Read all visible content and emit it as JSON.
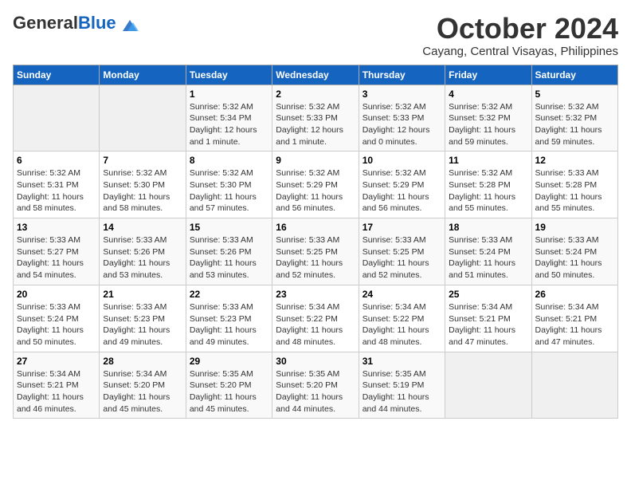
{
  "header": {
    "logo": {
      "general": "General",
      "blue": "Blue"
    },
    "title": "October 2024",
    "location": "Cayang, Central Visayas, Philippines"
  },
  "weekdays": [
    "Sunday",
    "Monday",
    "Tuesday",
    "Wednesday",
    "Thursday",
    "Friday",
    "Saturday"
  ],
  "weeks": [
    [
      {
        "day": "",
        "sunrise": "",
        "sunset": "",
        "daylight": ""
      },
      {
        "day": "",
        "sunrise": "",
        "sunset": "",
        "daylight": ""
      },
      {
        "day": "1",
        "sunrise": "Sunrise: 5:32 AM",
        "sunset": "Sunset: 5:34 PM",
        "daylight": "Daylight: 12 hours and 1 minute."
      },
      {
        "day": "2",
        "sunrise": "Sunrise: 5:32 AM",
        "sunset": "Sunset: 5:33 PM",
        "daylight": "Daylight: 12 hours and 1 minute."
      },
      {
        "day": "3",
        "sunrise": "Sunrise: 5:32 AM",
        "sunset": "Sunset: 5:33 PM",
        "daylight": "Daylight: 12 hours and 0 minutes."
      },
      {
        "day": "4",
        "sunrise": "Sunrise: 5:32 AM",
        "sunset": "Sunset: 5:32 PM",
        "daylight": "Daylight: 11 hours and 59 minutes."
      },
      {
        "day": "5",
        "sunrise": "Sunrise: 5:32 AM",
        "sunset": "Sunset: 5:32 PM",
        "daylight": "Daylight: 11 hours and 59 minutes."
      }
    ],
    [
      {
        "day": "6",
        "sunrise": "Sunrise: 5:32 AM",
        "sunset": "Sunset: 5:31 PM",
        "daylight": "Daylight: 11 hours and 58 minutes."
      },
      {
        "day": "7",
        "sunrise": "Sunrise: 5:32 AM",
        "sunset": "Sunset: 5:30 PM",
        "daylight": "Daylight: 11 hours and 58 minutes."
      },
      {
        "day": "8",
        "sunrise": "Sunrise: 5:32 AM",
        "sunset": "Sunset: 5:30 PM",
        "daylight": "Daylight: 11 hours and 57 minutes."
      },
      {
        "day": "9",
        "sunrise": "Sunrise: 5:32 AM",
        "sunset": "Sunset: 5:29 PM",
        "daylight": "Daylight: 11 hours and 56 minutes."
      },
      {
        "day": "10",
        "sunrise": "Sunrise: 5:32 AM",
        "sunset": "Sunset: 5:29 PM",
        "daylight": "Daylight: 11 hours and 56 minutes."
      },
      {
        "day": "11",
        "sunrise": "Sunrise: 5:32 AM",
        "sunset": "Sunset: 5:28 PM",
        "daylight": "Daylight: 11 hours and 55 minutes."
      },
      {
        "day": "12",
        "sunrise": "Sunrise: 5:33 AM",
        "sunset": "Sunset: 5:28 PM",
        "daylight": "Daylight: 11 hours and 55 minutes."
      }
    ],
    [
      {
        "day": "13",
        "sunrise": "Sunrise: 5:33 AM",
        "sunset": "Sunset: 5:27 PM",
        "daylight": "Daylight: 11 hours and 54 minutes."
      },
      {
        "day": "14",
        "sunrise": "Sunrise: 5:33 AM",
        "sunset": "Sunset: 5:26 PM",
        "daylight": "Daylight: 11 hours and 53 minutes."
      },
      {
        "day": "15",
        "sunrise": "Sunrise: 5:33 AM",
        "sunset": "Sunset: 5:26 PM",
        "daylight": "Daylight: 11 hours and 53 minutes."
      },
      {
        "day": "16",
        "sunrise": "Sunrise: 5:33 AM",
        "sunset": "Sunset: 5:25 PM",
        "daylight": "Daylight: 11 hours and 52 minutes."
      },
      {
        "day": "17",
        "sunrise": "Sunrise: 5:33 AM",
        "sunset": "Sunset: 5:25 PM",
        "daylight": "Daylight: 11 hours and 52 minutes."
      },
      {
        "day": "18",
        "sunrise": "Sunrise: 5:33 AM",
        "sunset": "Sunset: 5:24 PM",
        "daylight": "Daylight: 11 hours and 51 minutes."
      },
      {
        "day": "19",
        "sunrise": "Sunrise: 5:33 AM",
        "sunset": "Sunset: 5:24 PM",
        "daylight": "Daylight: 11 hours and 50 minutes."
      }
    ],
    [
      {
        "day": "20",
        "sunrise": "Sunrise: 5:33 AM",
        "sunset": "Sunset: 5:24 PM",
        "daylight": "Daylight: 11 hours and 50 minutes."
      },
      {
        "day": "21",
        "sunrise": "Sunrise: 5:33 AM",
        "sunset": "Sunset: 5:23 PM",
        "daylight": "Daylight: 11 hours and 49 minutes."
      },
      {
        "day": "22",
        "sunrise": "Sunrise: 5:33 AM",
        "sunset": "Sunset: 5:23 PM",
        "daylight": "Daylight: 11 hours and 49 minutes."
      },
      {
        "day": "23",
        "sunrise": "Sunrise: 5:34 AM",
        "sunset": "Sunset: 5:22 PM",
        "daylight": "Daylight: 11 hours and 48 minutes."
      },
      {
        "day": "24",
        "sunrise": "Sunrise: 5:34 AM",
        "sunset": "Sunset: 5:22 PM",
        "daylight": "Daylight: 11 hours and 48 minutes."
      },
      {
        "day": "25",
        "sunrise": "Sunrise: 5:34 AM",
        "sunset": "Sunset: 5:21 PM",
        "daylight": "Daylight: 11 hours and 47 minutes."
      },
      {
        "day": "26",
        "sunrise": "Sunrise: 5:34 AM",
        "sunset": "Sunset: 5:21 PM",
        "daylight": "Daylight: 11 hours and 47 minutes."
      }
    ],
    [
      {
        "day": "27",
        "sunrise": "Sunrise: 5:34 AM",
        "sunset": "Sunset: 5:21 PM",
        "daylight": "Daylight: 11 hours and 46 minutes."
      },
      {
        "day": "28",
        "sunrise": "Sunrise: 5:34 AM",
        "sunset": "Sunset: 5:20 PM",
        "daylight": "Daylight: 11 hours and 45 minutes."
      },
      {
        "day": "29",
        "sunrise": "Sunrise: 5:35 AM",
        "sunset": "Sunset: 5:20 PM",
        "daylight": "Daylight: 11 hours and 45 minutes."
      },
      {
        "day": "30",
        "sunrise": "Sunrise: 5:35 AM",
        "sunset": "Sunset: 5:20 PM",
        "daylight": "Daylight: 11 hours and 44 minutes."
      },
      {
        "day": "31",
        "sunrise": "Sunrise: 5:35 AM",
        "sunset": "Sunset: 5:19 PM",
        "daylight": "Daylight: 11 hours and 44 minutes."
      },
      {
        "day": "",
        "sunrise": "",
        "sunset": "",
        "daylight": ""
      },
      {
        "day": "",
        "sunrise": "",
        "sunset": "",
        "daylight": ""
      }
    ]
  ]
}
